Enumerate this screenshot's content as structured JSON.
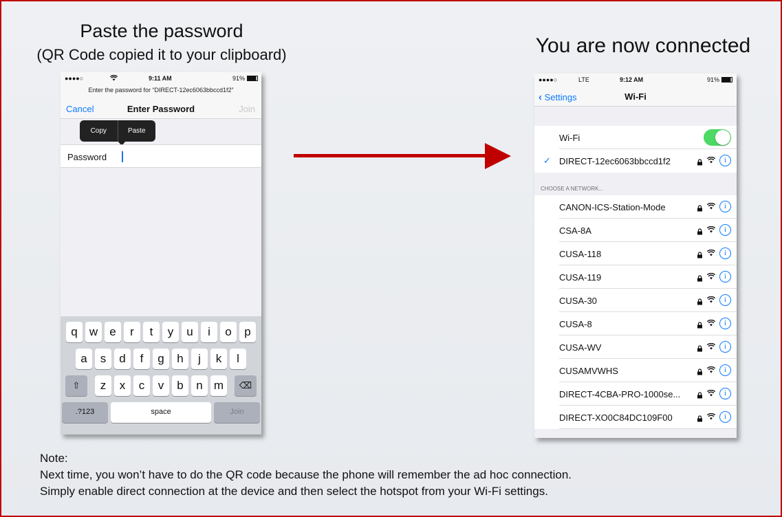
{
  "heading_left": "Paste the password",
  "heading_left_sub": "(QR Code copied it to your clipboard)",
  "heading_right": "You are now connected",
  "phone1": {
    "status": {
      "signal": "●●●●○",
      "time": "9:11 AM",
      "battery": "91%"
    },
    "prompt": "Enter the password for “DIRECT-12ec6063bbccd1f2”",
    "nav": {
      "cancel": "Cancel",
      "title": "Enter Password",
      "join": "Join"
    },
    "edit_menu": {
      "copy": "Copy",
      "paste": "Paste"
    },
    "password_label": "Password",
    "keyboard": {
      "row1": [
        "q",
        "w",
        "e",
        "r",
        "t",
        "y",
        "u",
        "i",
        "o",
        "p"
      ],
      "row2": [
        "a",
        "s",
        "d",
        "f",
        "g",
        "h",
        "j",
        "k",
        "l"
      ],
      "row3": [
        "z",
        "x",
        "c",
        "v",
        "b",
        "n",
        "m"
      ],
      "shift": "⇧",
      "delete": "⌫",
      "numbers": ".?123",
      "space": "space",
      "join": "Join"
    }
  },
  "phone2": {
    "status": {
      "signal": "●●●●○",
      "carrier": "LTE",
      "time": "9:12 AM",
      "battery": "91%"
    },
    "nav": {
      "back": "Settings",
      "title": "Wi-Fi"
    },
    "wifi_label": "Wi-Fi",
    "wifi_on": true,
    "connected": "DIRECT-12ec6063bbccd1f2",
    "section": "CHOOSE A NETWORK...",
    "networks": [
      "CANON-ICS-Station-Mode",
      "CSA-8A",
      "CUSA-118",
      "CUSA-119",
      "CUSA-30",
      "CUSA-8",
      "CUSA-WV",
      "CUSAMVWHS",
      "DIRECT-4CBA-PRO-1000se...",
      "DIRECT-XO0C84DC109F00"
    ]
  },
  "note": {
    "title": "Note:",
    "line1": "Next time, you won’t have to do the QR code because the phone will remember the ad hoc connection.",
    "line2": "Simply enable direct connection at the device and then select the hotspot from your Wi-Fi settings."
  },
  "colors": {
    "accent": "#c00000",
    "ios_blue": "#0a7aff",
    "toggle_green": "#4cd964"
  }
}
